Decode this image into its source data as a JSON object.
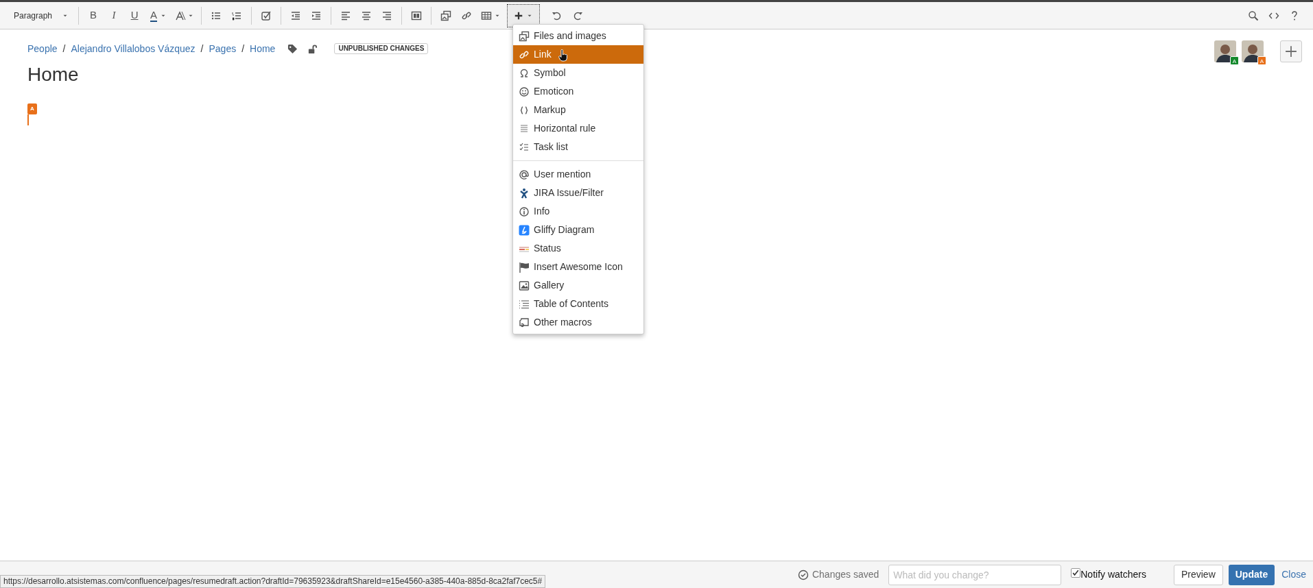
{
  "toolbar": {
    "paragraph_style": "Paragraph",
    "format_buttons": [
      "B",
      "I",
      "U",
      "A"
    ],
    "insert_menu_expanded": true
  },
  "breadcrumbs": [
    "People",
    "Alejandro Villalobos Vázquez",
    "Pages",
    "Home"
  ],
  "breadcrumb_separators": [
    "/",
    "/",
    "/"
  ],
  "status_lozenge": "UNPUBLISHED CHANGES",
  "page_title": "Home",
  "cursor_flag": {
    "label": "A",
    "color": "#e8701a"
  },
  "collaborators": [
    {
      "badge": "A",
      "color": "#14892c"
    },
    {
      "badge": "A",
      "color": "#e8701a"
    }
  ],
  "insert_menu": {
    "groups": [
      [
        {
          "label": "Files and images",
          "selected": false
        },
        {
          "label": "Link",
          "selected": true
        },
        {
          "label": "Symbol",
          "selected": false
        },
        {
          "label": "Emoticon",
          "selected": false
        },
        {
          "label": "Markup",
          "selected": false
        },
        {
          "label": "Horizontal rule",
          "selected": false
        },
        {
          "label": "Task list",
          "selected": false
        }
      ],
      [
        {
          "label": "User mention",
          "selected": false
        },
        {
          "label": "JIRA Issue/Filter",
          "selected": false
        },
        {
          "label": "Info",
          "selected": false
        },
        {
          "label": "Gliffy Diagram",
          "selected": false
        },
        {
          "label": "Status",
          "selected": false
        },
        {
          "label": "Insert Awesome Icon",
          "selected": false
        },
        {
          "label": "Gallery",
          "selected": false
        },
        {
          "label": "Table of Contents",
          "selected": false
        },
        {
          "label": "Other macros",
          "selected": false
        }
      ]
    ]
  },
  "footer": {
    "save_status": "Changes saved",
    "comment_placeholder": "What did you change?",
    "notify_watchers": {
      "label": "Notify watchers",
      "checked": true
    },
    "buttons": [
      "Preview",
      "Update",
      "Close"
    ]
  },
  "status_url": "https://desarrollo.atsistemas.com/confluence/pages/resumedraft.action?draftId=79635923&draftShareId=e15e4560-a385-440a-885d-8ca2faf7cec5#"
}
